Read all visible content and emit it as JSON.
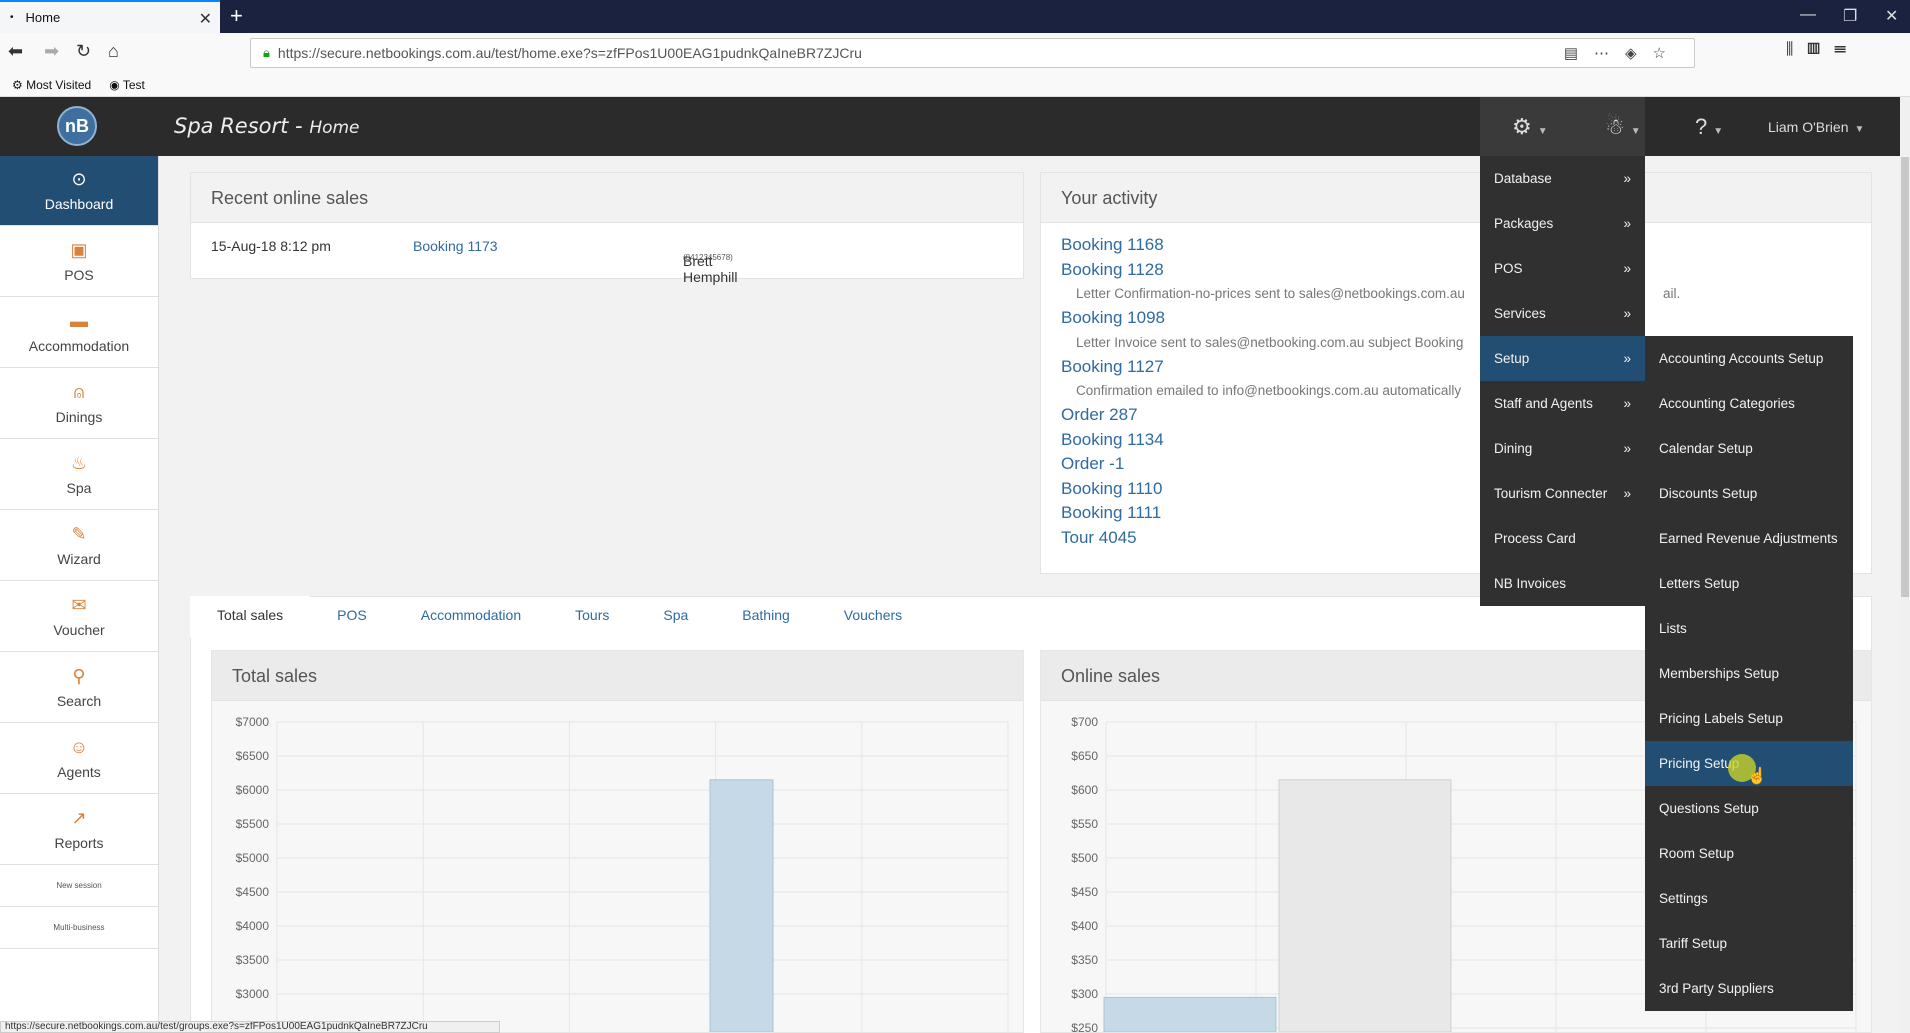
{
  "browser": {
    "tab_title": "Home",
    "url": "https://secure.netbookings.com.au/test/home.exe?s=zfFPos1U00EAG1pudnkQaIneBR7ZJCru",
    "bookmarks": [
      "Most Visited",
      "Test"
    ],
    "status_url": "https://secure.netbookings.com.au/test/groups.exe?s=zfFPos1U00EAG1pudnkQaIneBR7ZJCru"
  },
  "header": {
    "logo_text": "nB",
    "title": "Spa Resort",
    "subtitle": "Home",
    "user_name": "Liam O'Brien"
  },
  "sidebar": {
    "items": [
      {
        "label": "Dashboard",
        "icon": "⊙"
      },
      {
        "label": "POS",
        "icon": "▣"
      },
      {
        "label": "Accommodation",
        "icon": "▬"
      },
      {
        "label": "Dinings",
        "icon": "⍝"
      },
      {
        "label": "Spa",
        "icon": "♨"
      },
      {
        "label": "Wizard",
        "icon": "✎"
      },
      {
        "label": "Voucher",
        "icon": "✉"
      },
      {
        "label": "Search",
        "icon": "⚲"
      },
      {
        "label": "Agents",
        "icon": "☺"
      },
      {
        "label": "Reports",
        "icon": "↗"
      }
    ],
    "new_session": "New session",
    "multi_business": "Multi-business"
  },
  "recent_sales": {
    "title": "Recent online sales",
    "date": "15-Aug-18 8:12 pm",
    "booking": "Booking 1173",
    "customer": "Brett Hemphill",
    "phone": "(0412345678)"
  },
  "activity": {
    "title": "Your activity",
    "links": [
      "Booking 1168",
      "Booking 1128",
      "Booking 1098",
      "Booking 1127",
      "Order 287",
      "Booking 1134",
      "Order -1",
      "Booking 1110",
      "Booking 1111",
      "Tour 4045"
    ],
    "notes": [
      "Letter Confirmation-no-prices sent to sales@netbookings.com.au",
      "Letter Invoice sent to sales@netbooking.com.au subject Booking",
      "Confirmation emailed to info@netbookings.com.au automatically"
    ],
    "note_tail": "ail."
  },
  "tabs": [
    "Total sales",
    "POS",
    "Accommodation",
    "Tours",
    "Spa",
    "Bathing",
    "Vouchers"
  ],
  "total_sales_title": "Total sales",
  "online_sales_title": "Online sales",
  "chart_data": [
    {
      "type": "bar",
      "title": "Total sales",
      "ylim": [
        3000,
        7000
      ],
      "yticks": [
        "$7000",
        "$6500",
        "$6000",
        "$5500",
        "$5000",
        "$4500",
        "$4000",
        "$3500",
        "$3000"
      ],
      "values": [
        null,
        null,
        null,
        6150,
        null
      ],
      "grid": true
    },
    {
      "type": "bar",
      "title": "Online sales",
      "ylim": [
        250,
        700
      ],
      "yticks": [
        "$700",
        "$650",
        "$600",
        "$550",
        "$500",
        "$450",
        "$400",
        "$350",
        "$300",
        "$250"
      ],
      "series": [
        {
          "values": [
            295,
            615
          ]
        }
      ],
      "grid": true
    }
  ],
  "menu": {
    "level1": [
      "Database",
      "Packages",
      "POS",
      "Services",
      "Setup",
      "Staff and Agents",
      "Dining",
      "Tourism Connecter",
      "Process Card",
      "NB Invoices"
    ],
    "level1_has_sub": [
      true,
      true,
      true,
      true,
      true,
      true,
      true,
      true,
      false,
      false
    ],
    "level1_active": "Setup",
    "arrow": "»",
    "level2": [
      "Accounting Accounts Setup",
      "Accounting Categories",
      "Calendar Setup",
      "Discounts Setup",
      "Earned Revenue Adjustments",
      "Letters Setup",
      "Lists",
      "Memberships Setup",
      "Pricing Labels Setup",
      "Pricing Setup",
      "Questions Setup",
      "Room Setup",
      "Settings",
      "Tariff Setup",
      "3rd Party Suppliers"
    ],
    "level2_active": "Pricing Setup"
  },
  "colors": {
    "header_bg": "#2b2b2b",
    "active_blue": "#234e74",
    "link": "#2f6aa3",
    "accent_orange": "#d9823b",
    "bar_fill": "#c6d9e6"
  }
}
